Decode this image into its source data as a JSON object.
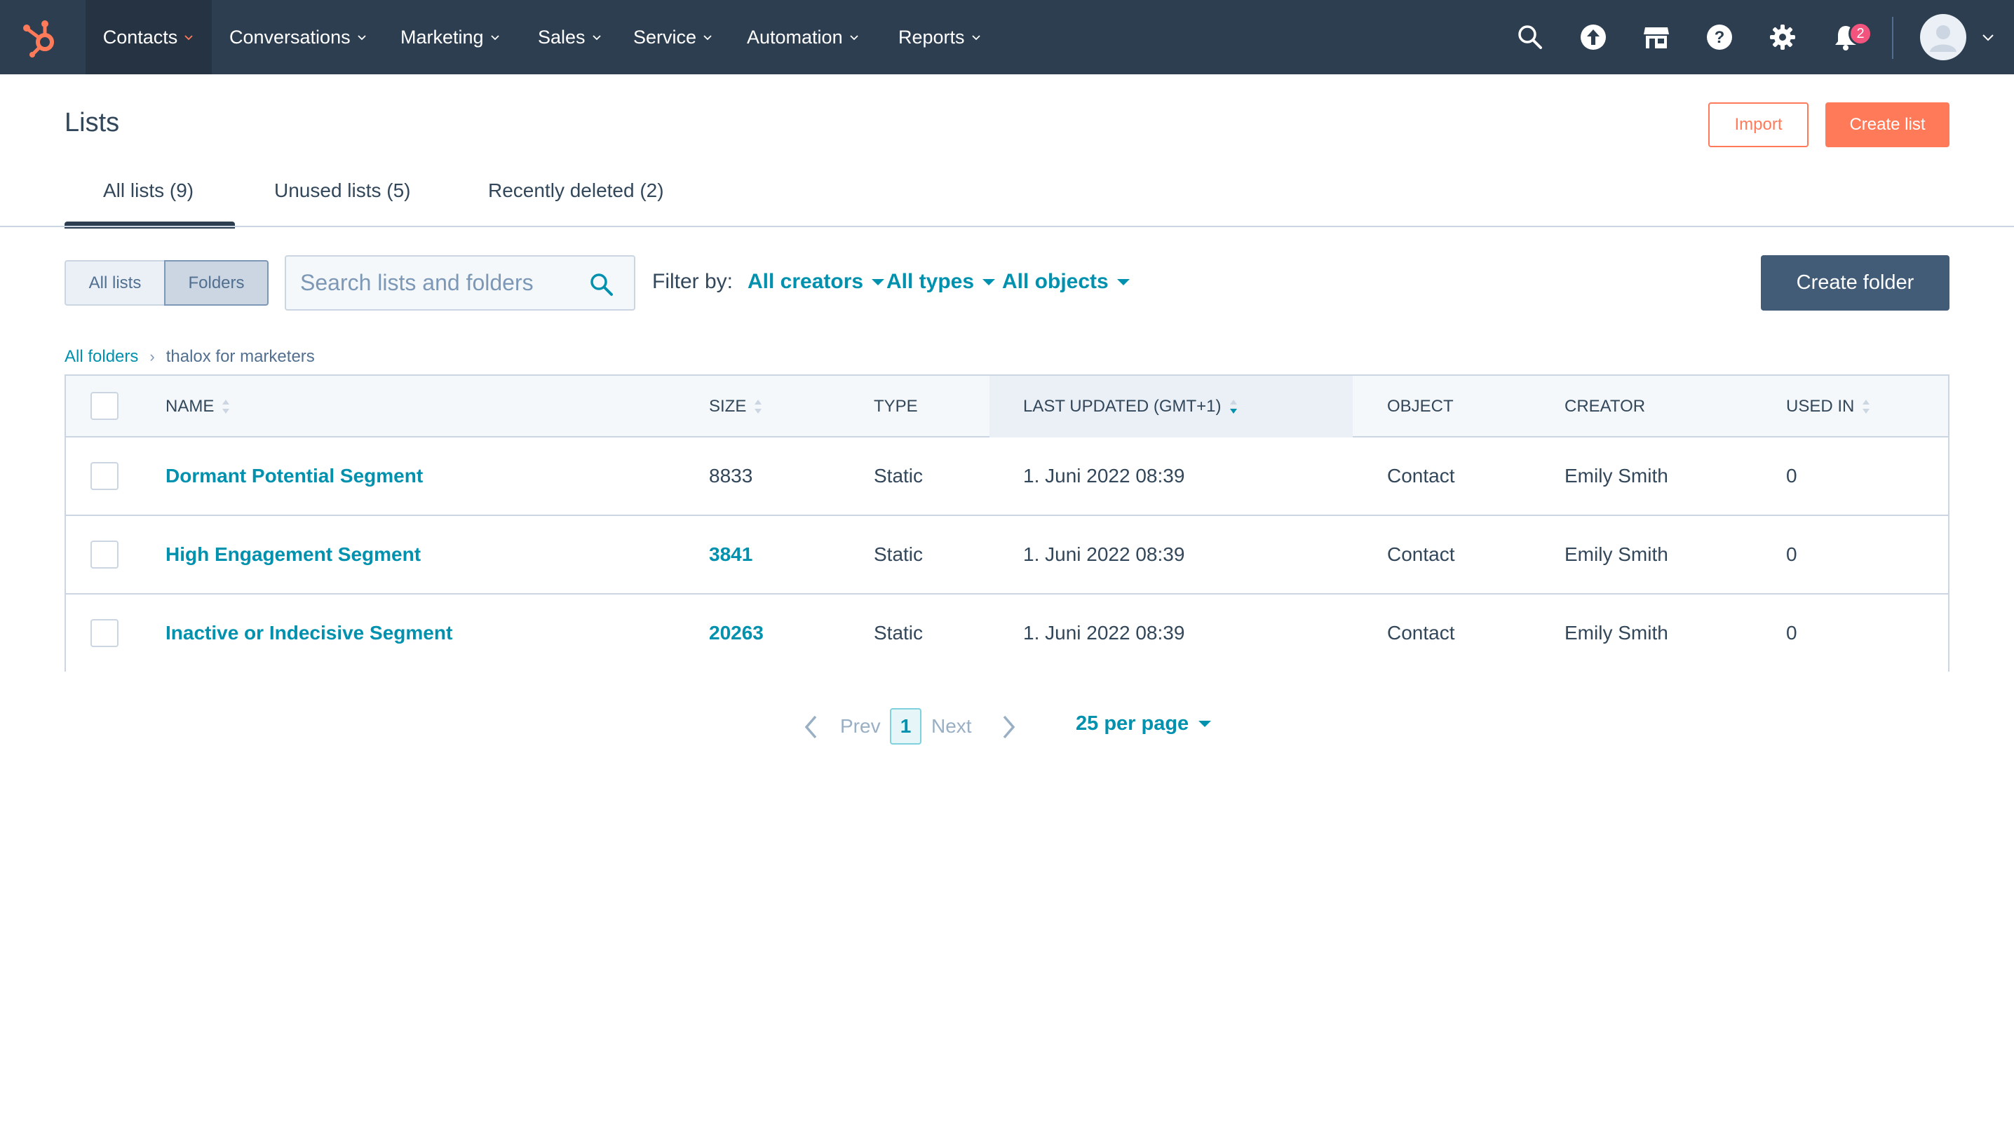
{
  "nav": {
    "items": [
      {
        "label": "Contacts",
        "active": true
      },
      {
        "label": "Conversations"
      },
      {
        "label": "Marketing"
      },
      {
        "label": "Sales"
      },
      {
        "label": "Service"
      },
      {
        "label": "Automation"
      },
      {
        "label": "Reports"
      }
    ],
    "notifications_count": "2",
    "icons": [
      "search-icon",
      "upgrade-icon",
      "marketplace-icon",
      "help-icon",
      "settings-icon",
      "notifications-icon"
    ]
  },
  "header": {
    "title": "Lists",
    "import_label": "Import",
    "create_list_label": "Create list"
  },
  "tabs": [
    {
      "label": "All lists (9)",
      "active": true
    },
    {
      "label": "Unused lists (5)"
    },
    {
      "label": "Recently deleted (2)"
    }
  ],
  "view_toggle": {
    "all_lists": "All lists",
    "folders": "Folders",
    "selected": "Folders"
  },
  "search": {
    "placeholder": "Search lists and folders",
    "value": ""
  },
  "filters": {
    "label": "Filter by:",
    "creators": "All creators",
    "types": "All types",
    "objects": "All objects"
  },
  "create_folder_label": "Create folder",
  "breadcrumb": {
    "root": "All folders",
    "separator": "›",
    "current": "thalox for marketers"
  },
  "table": {
    "columns": {
      "name": "NAME",
      "size": "SIZE",
      "type": "TYPE",
      "last_updated": "LAST UPDATED (GMT+1)",
      "object": "OBJECT",
      "creator": "CREATOR",
      "used_in": "USED IN"
    },
    "rows": [
      {
        "name": "Dormant Potential Segment",
        "size": "8833",
        "size_link": false,
        "type": "Static",
        "last_updated": "1. Juni 2022 08:39",
        "object": "Contact",
        "creator": "Emily Smith",
        "used_in": "0"
      },
      {
        "name": "High Engagement Segment",
        "size": "3841",
        "size_link": true,
        "type": "Static",
        "last_updated": "1. Juni 2022 08:39",
        "object": "Contact",
        "creator": "Emily Smith",
        "used_in": "0"
      },
      {
        "name": "Inactive or Indecisive Segment",
        "size": "20263",
        "size_link": true,
        "type": "Static",
        "last_updated": "1. Juni 2022 08:39",
        "object": "Contact",
        "creator": "Emily Smith",
        "used_in": "0"
      }
    ]
  },
  "pagination": {
    "prev": "Prev",
    "current_page": "1",
    "next": "Next",
    "per_page": "25 per page"
  },
  "colors": {
    "nav_bg": "#2d3e50",
    "accent": "#ff7a59",
    "link": "#0091ae",
    "text": "#33475b",
    "border": "#cbd6e2"
  }
}
